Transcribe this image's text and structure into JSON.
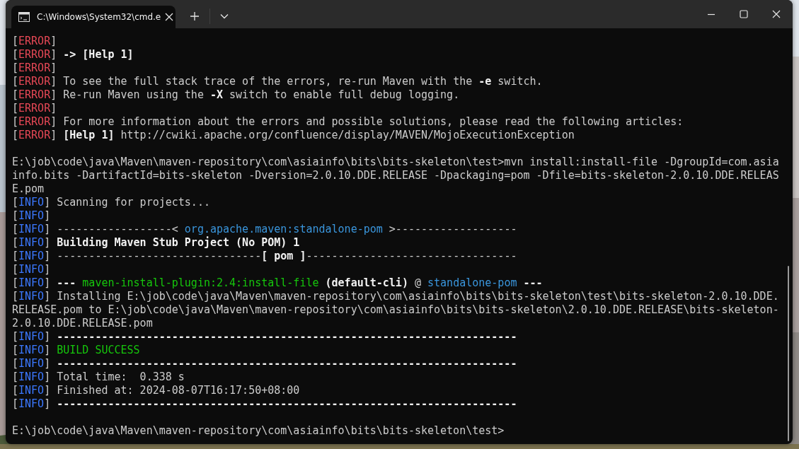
{
  "window": {
    "tabs": [
      {
        "title": "C:\\Windows\\System32\\cmd.e",
        "selected": true
      }
    ]
  },
  "console": {
    "lines": [
      {
        "kind": "text",
        "segments": [
          {
            "text": "[",
            "kind": "plain"
          },
          {
            "text": "ERROR",
            "kind": "error"
          },
          {
            "text": "]",
            "kind": "plain"
          }
        ]
      },
      {
        "kind": "text",
        "segments": [
          {
            "text": "[",
            "kind": "plain"
          },
          {
            "text": "ERROR",
            "kind": "error"
          },
          {
            "text": "] ",
            "kind": "plain"
          },
          {
            "text": "-> [Help 1]",
            "kind": "bright"
          }
        ]
      },
      {
        "kind": "text",
        "segments": [
          {
            "text": "[",
            "kind": "plain"
          },
          {
            "text": "ERROR",
            "kind": "error"
          },
          {
            "text": "]",
            "kind": "plain"
          }
        ]
      },
      {
        "kind": "text",
        "segments": [
          {
            "text": "[",
            "kind": "plain"
          },
          {
            "text": "ERROR",
            "kind": "error"
          },
          {
            "text": "] To see the full stack trace of the errors, re-run Maven with the ",
            "kind": "plain"
          },
          {
            "text": "-e",
            "kind": "bright"
          },
          {
            "text": " switch.",
            "kind": "plain"
          }
        ]
      },
      {
        "kind": "text",
        "segments": [
          {
            "text": "[",
            "kind": "plain"
          },
          {
            "text": "ERROR",
            "kind": "error"
          },
          {
            "text": "] Re-run Maven using the ",
            "kind": "plain"
          },
          {
            "text": "-X",
            "kind": "bright"
          },
          {
            "text": " switch to enable full debug logging.",
            "kind": "plain"
          }
        ]
      },
      {
        "kind": "text",
        "segments": [
          {
            "text": "[",
            "kind": "plain"
          },
          {
            "text": "ERROR",
            "kind": "error"
          },
          {
            "text": "]",
            "kind": "plain"
          }
        ]
      },
      {
        "kind": "text",
        "segments": [
          {
            "text": "[",
            "kind": "plain"
          },
          {
            "text": "ERROR",
            "kind": "error"
          },
          {
            "text": "] For more information about the errors and possible solutions, please read the following articles:",
            "kind": "plain"
          }
        ]
      },
      {
        "kind": "text",
        "segments": [
          {
            "text": "[",
            "kind": "plain"
          },
          {
            "text": "ERROR",
            "kind": "error"
          },
          {
            "text": "] ",
            "kind": "plain"
          },
          {
            "text": "[Help 1]",
            "kind": "bright"
          },
          {
            "text": " http://cwiki.apache.org/confluence/display/MAVEN/MojoExecutionException",
            "kind": "plain"
          }
        ]
      },
      {
        "kind": "blank"
      },
      {
        "kind": "text",
        "segments": [
          {
            "text": "E:\\job\\code\\java\\Maven\\maven-repository\\com\\asiainfo\\bits\\bits-skeleton\\test>mvn install:install-file -DgroupId=com.asia",
            "kind": "plain"
          }
        ]
      },
      {
        "kind": "text",
        "segments": [
          {
            "text": "info.bits -DartifactId=bits-skeleton -Dversion=2.0.10.DDE.RELEASE -Dpackaging=pom -Dfile=bits-skeleton-2.0.10.DDE.RELEAS",
            "kind": "plain"
          }
        ]
      },
      {
        "kind": "text",
        "segments": [
          {
            "text": "E.pom",
            "kind": "plain"
          }
        ]
      },
      {
        "kind": "text",
        "segments": [
          {
            "text": "[",
            "kind": "plain"
          },
          {
            "text": "INFO",
            "kind": "info"
          },
          {
            "text": "] Scanning for projects...",
            "kind": "plain"
          }
        ]
      },
      {
        "kind": "text",
        "segments": [
          {
            "text": "[",
            "kind": "plain"
          },
          {
            "text": "INFO",
            "kind": "info"
          },
          {
            "text": "]",
            "kind": "plain"
          }
        ]
      },
      {
        "kind": "text",
        "segments": [
          {
            "text": "[",
            "kind": "plain"
          },
          {
            "text": "INFO",
            "kind": "info"
          },
          {
            "text": "] ------------------< ",
            "kind": "plain"
          },
          {
            "text": "org.apache.maven:standalone-pom",
            "kind": "link"
          },
          {
            "text": " >-------------------",
            "kind": "plain"
          }
        ]
      },
      {
        "kind": "text",
        "segments": [
          {
            "text": "[",
            "kind": "plain"
          },
          {
            "text": "INFO",
            "kind": "info"
          },
          {
            "text": "] ",
            "kind": "plain"
          },
          {
            "text": "Building Maven Stub Project (No POM) 1",
            "kind": "bright"
          }
        ]
      },
      {
        "kind": "text",
        "segments": [
          {
            "text": "[",
            "kind": "plain"
          },
          {
            "text": "INFO",
            "kind": "info"
          },
          {
            "text": "] --------------------------------",
            "kind": "plain"
          },
          {
            "text": "[ pom ]",
            "kind": "bright"
          },
          {
            "text": "---------------------------------",
            "kind": "plain"
          }
        ]
      },
      {
        "kind": "text",
        "segments": [
          {
            "text": "[",
            "kind": "plain"
          },
          {
            "text": "INFO",
            "kind": "info"
          },
          {
            "text": "]",
            "kind": "plain"
          }
        ]
      },
      {
        "kind": "text",
        "segments": [
          {
            "text": "[",
            "kind": "plain"
          },
          {
            "text": "INFO",
            "kind": "info"
          },
          {
            "text": "] ",
            "kind": "plain"
          },
          {
            "text": "---",
            "kind": "bright"
          },
          {
            "text": " maven-install-plugin:2.4:install-file",
            "kind": "green"
          },
          {
            "text": " (default-cli)",
            "kind": "bright"
          },
          {
            "text": " @ ",
            "kind": "plain"
          },
          {
            "text": "standalone-pom",
            "kind": "link"
          },
          {
            "text": " ---",
            "kind": "bright"
          }
        ]
      },
      {
        "kind": "text",
        "segments": [
          {
            "text": "[",
            "kind": "plain"
          },
          {
            "text": "INFO",
            "kind": "info"
          },
          {
            "text": "] Installing E:\\job\\code\\java\\Maven\\maven-repository\\com\\asiainfo\\bits\\bits-skeleton\\test\\bits-skeleton-2.0.10.DDE.",
            "kind": "plain"
          }
        ]
      },
      {
        "kind": "text",
        "segments": [
          {
            "text": "RELEASE.pom to E:\\job\\code\\java\\Maven\\maven-repository\\com\\asiainfo\\bits\\bits-skeleton\\2.0.10.DDE.RELEASE\\bits-skeleton-",
            "kind": "plain"
          }
        ]
      },
      {
        "kind": "text",
        "segments": [
          {
            "text": "2.0.10.DDE.RELEASE.pom",
            "kind": "plain"
          }
        ]
      },
      {
        "kind": "text",
        "segments": [
          {
            "text": "[",
            "kind": "plain"
          },
          {
            "text": "INFO",
            "kind": "info"
          },
          {
            "text": "] ",
            "kind": "plain"
          },
          {
            "text": "------------------------------------------------------------------------",
            "kind": "bright"
          }
        ]
      },
      {
        "kind": "text",
        "segments": [
          {
            "text": "[",
            "kind": "plain"
          },
          {
            "text": "INFO",
            "kind": "info"
          },
          {
            "text": "] ",
            "kind": "plain"
          },
          {
            "text": "BUILD SUCCESS",
            "kind": "green"
          }
        ]
      },
      {
        "kind": "text",
        "segments": [
          {
            "text": "[",
            "kind": "plain"
          },
          {
            "text": "INFO",
            "kind": "info"
          },
          {
            "text": "] ",
            "kind": "plain"
          },
          {
            "text": "------------------------------------------------------------------------",
            "kind": "bright"
          }
        ]
      },
      {
        "kind": "text",
        "segments": [
          {
            "text": "[",
            "kind": "plain"
          },
          {
            "text": "INFO",
            "kind": "info"
          },
          {
            "text": "] Total time:  0.338 s",
            "kind": "plain"
          }
        ]
      },
      {
        "kind": "text",
        "segments": [
          {
            "text": "[",
            "kind": "plain"
          },
          {
            "text": "INFO",
            "kind": "info"
          },
          {
            "text": "] Finished at: 2024-08-07T16:17:50+08:00",
            "kind": "plain"
          }
        ]
      },
      {
        "kind": "text",
        "segments": [
          {
            "text": "[",
            "kind": "plain"
          },
          {
            "text": "INFO",
            "kind": "info"
          },
          {
            "text": "] ",
            "kind": "plain"
          },
          {
            "text": "------------------------------------------------------------------------",
            "kind": "bright"
          }
        ]
      },
      {
        "kind": "blank"
      },
      {
        "kind": "text",
        "segments": [
          {
            "text": "E:\\job\\code\\java\\Maven\\maven-repository\\com\\asiainfo\\bits\\bits-skeleton\\test>",
            "kind": "plain"
          }
        ]
      }
    ]
  }
}
